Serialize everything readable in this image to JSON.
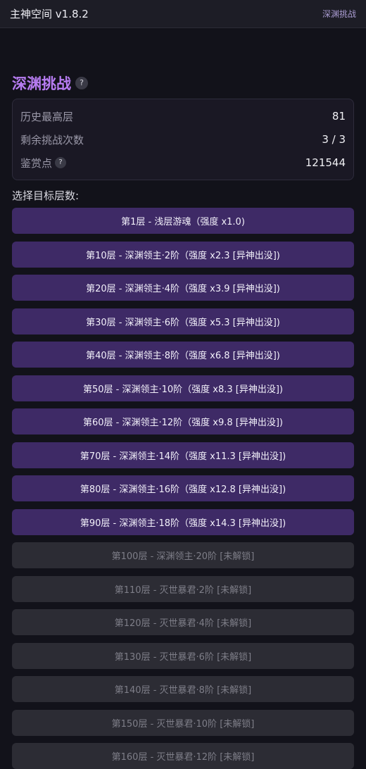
{
  "header": {
    "app_title": "主神空间 v1.8.2",
    "page_link": "深渊挑战"
  },
  "section": {
    "title": "深渊挑战",
    "help_glyph": "?"
  },
  "stats": {
    "highest_floor_label": "历史最高层",
    "highest_floor_value": "81",
    "remaining_label": "剩余挑战次数",
    "remaining_value": "3 / 3",
    "points_label": "鉴赏点",
    "points_help": "?",
    "points_value": "121544"
  },
  "choose_label": "选择目标层数:",
  "floors": [
    {
      "label": "第1层 - 浅层游魂（强度 x1.0)",
      "unlocked": true
    },
    {
      "label": "第10层 - 深渊领主·2阶（强度 x2.3 [异神出没])",
      "unlocked": true
    },
    {
      "label": "第20层 - 深渊领主·4阶（强度 x3.9 [异神出没])",
      "unlocked": true
    },
    {
      "label": "第30层 - 深渊领主·6阶（强度 x5.3 [异神出没])",
      "unlocked": true
    },
    {
      "label": "第40层 - 深渊领主·8阶（强度 x6.8 [异神出没])",
      "unlocked": true
    },
    {
      "label": "第50层 - 深渊领主·10阶（强度 x8.3 [异神出没])",
      "unlocked": true
    },
    {
      "label": "第60层 - 深渊领主·12阶（强度 x9.8 [异神出没])",
      "unlocked": true
    },
    {
      "label": "第70层 - 深渊领主·14阶（强度 x11.3 [异神出没])",
      "unlocked": true
    },
    {
      "label": "第80层 - 深渊领主·16阶（强度 x12.8 [异神出没])",
      "unlocked": true
    },
    {
      "label": "第90层 - 深渊领主·18阶（强度 x14.3 [异神出没])",
      "unlocked": true
    },
    {
      "label": "第100层 - 深渊领主·20阶 [未解锁]",
      "unlocked": false
    },
    {
      "label": "第110层 - 灭世暴君·2阶 [未解锁]",
      "unlocked": false
    },
    {
      "label": "第120层 - 灭世暴君·4阶 [未解锁]",
      "unlocked": false
    },
    {
      "label": "第130层 - 灭世暴君·6阶 [未解锁]",
      "unlocked": false
    },
    {
      "label": "第140层 - 灭世暴君·8阶 [未解锁]",
      "unlocked": false
    },
    {
      "label": "第150层 - 灭世暴君·10阶 [未解锁]",
      "unlocked": false
    },
    {
      "label": "第160层 - 灭世暴君·12阶 [未解锁]",
      "unlocked": false
    }
  ]
}
